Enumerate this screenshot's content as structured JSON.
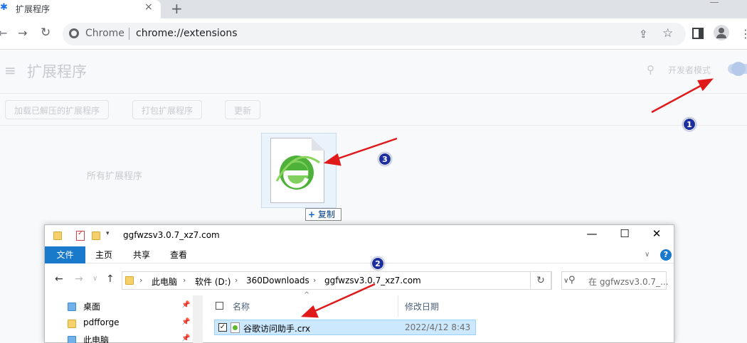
{
  "browser": {
    "tab_title": "扩展程序",
    "new_tab_symbol": "+",
    "close_symbol": "×",
    "omnibox": {
      "scheme_label": "Chrome",
      "url": "chrome://extensions"
    }
  },
  "extensions_page": {
    "title": "扩展程序",
    "developer_mode_label": "开发者模式",
    "buttons": [
      "加载已解压的扩展程序",
      "打包扩展程序",
      "更新"
    ],
    "all_extensions_label": "所有扩展程序"
  },
  "drag": {
    "copy_label": "复制"
  },
  "explorer": {
    "title": "ggfwzsv3.0.7_xz7.com",
    "ribbon_tabs": [
      "文件",
      "主页",
      "共享",
      "查看"
    ],
    "breadcrumb": [
      "此电脑",
      "软件 (D:)",
      "360Downloads",
      "ggfwzsv3.0.7_xz7.com"
    ],
    "search_placeholder": "在 ggfwzsv3.0.7_...",
    "nav_items": [
      "桌面",
      "pdfforge",
      "此电脑"
    ],
    "columns": {
      "name": "名称",
      "modified": "修改日期"
    },
    "files": [
      {
        "name": "谷歌访问助手.crx",
        "modified": "2022/4/12 8:43"
      }
    ]
  },
  "annotations": {
    "step1": "1",
    "step2": "2",
    "step3": "3",
    "arrow_color": "#e0191b",
    "badge_color": "#1d2f9e"
  },
  "colors": {
    "chrome_blue": "#1a73e8",
    "explorer_file_tab": "#1979ca",
    "selection": "#cce8ff"
  }
}
